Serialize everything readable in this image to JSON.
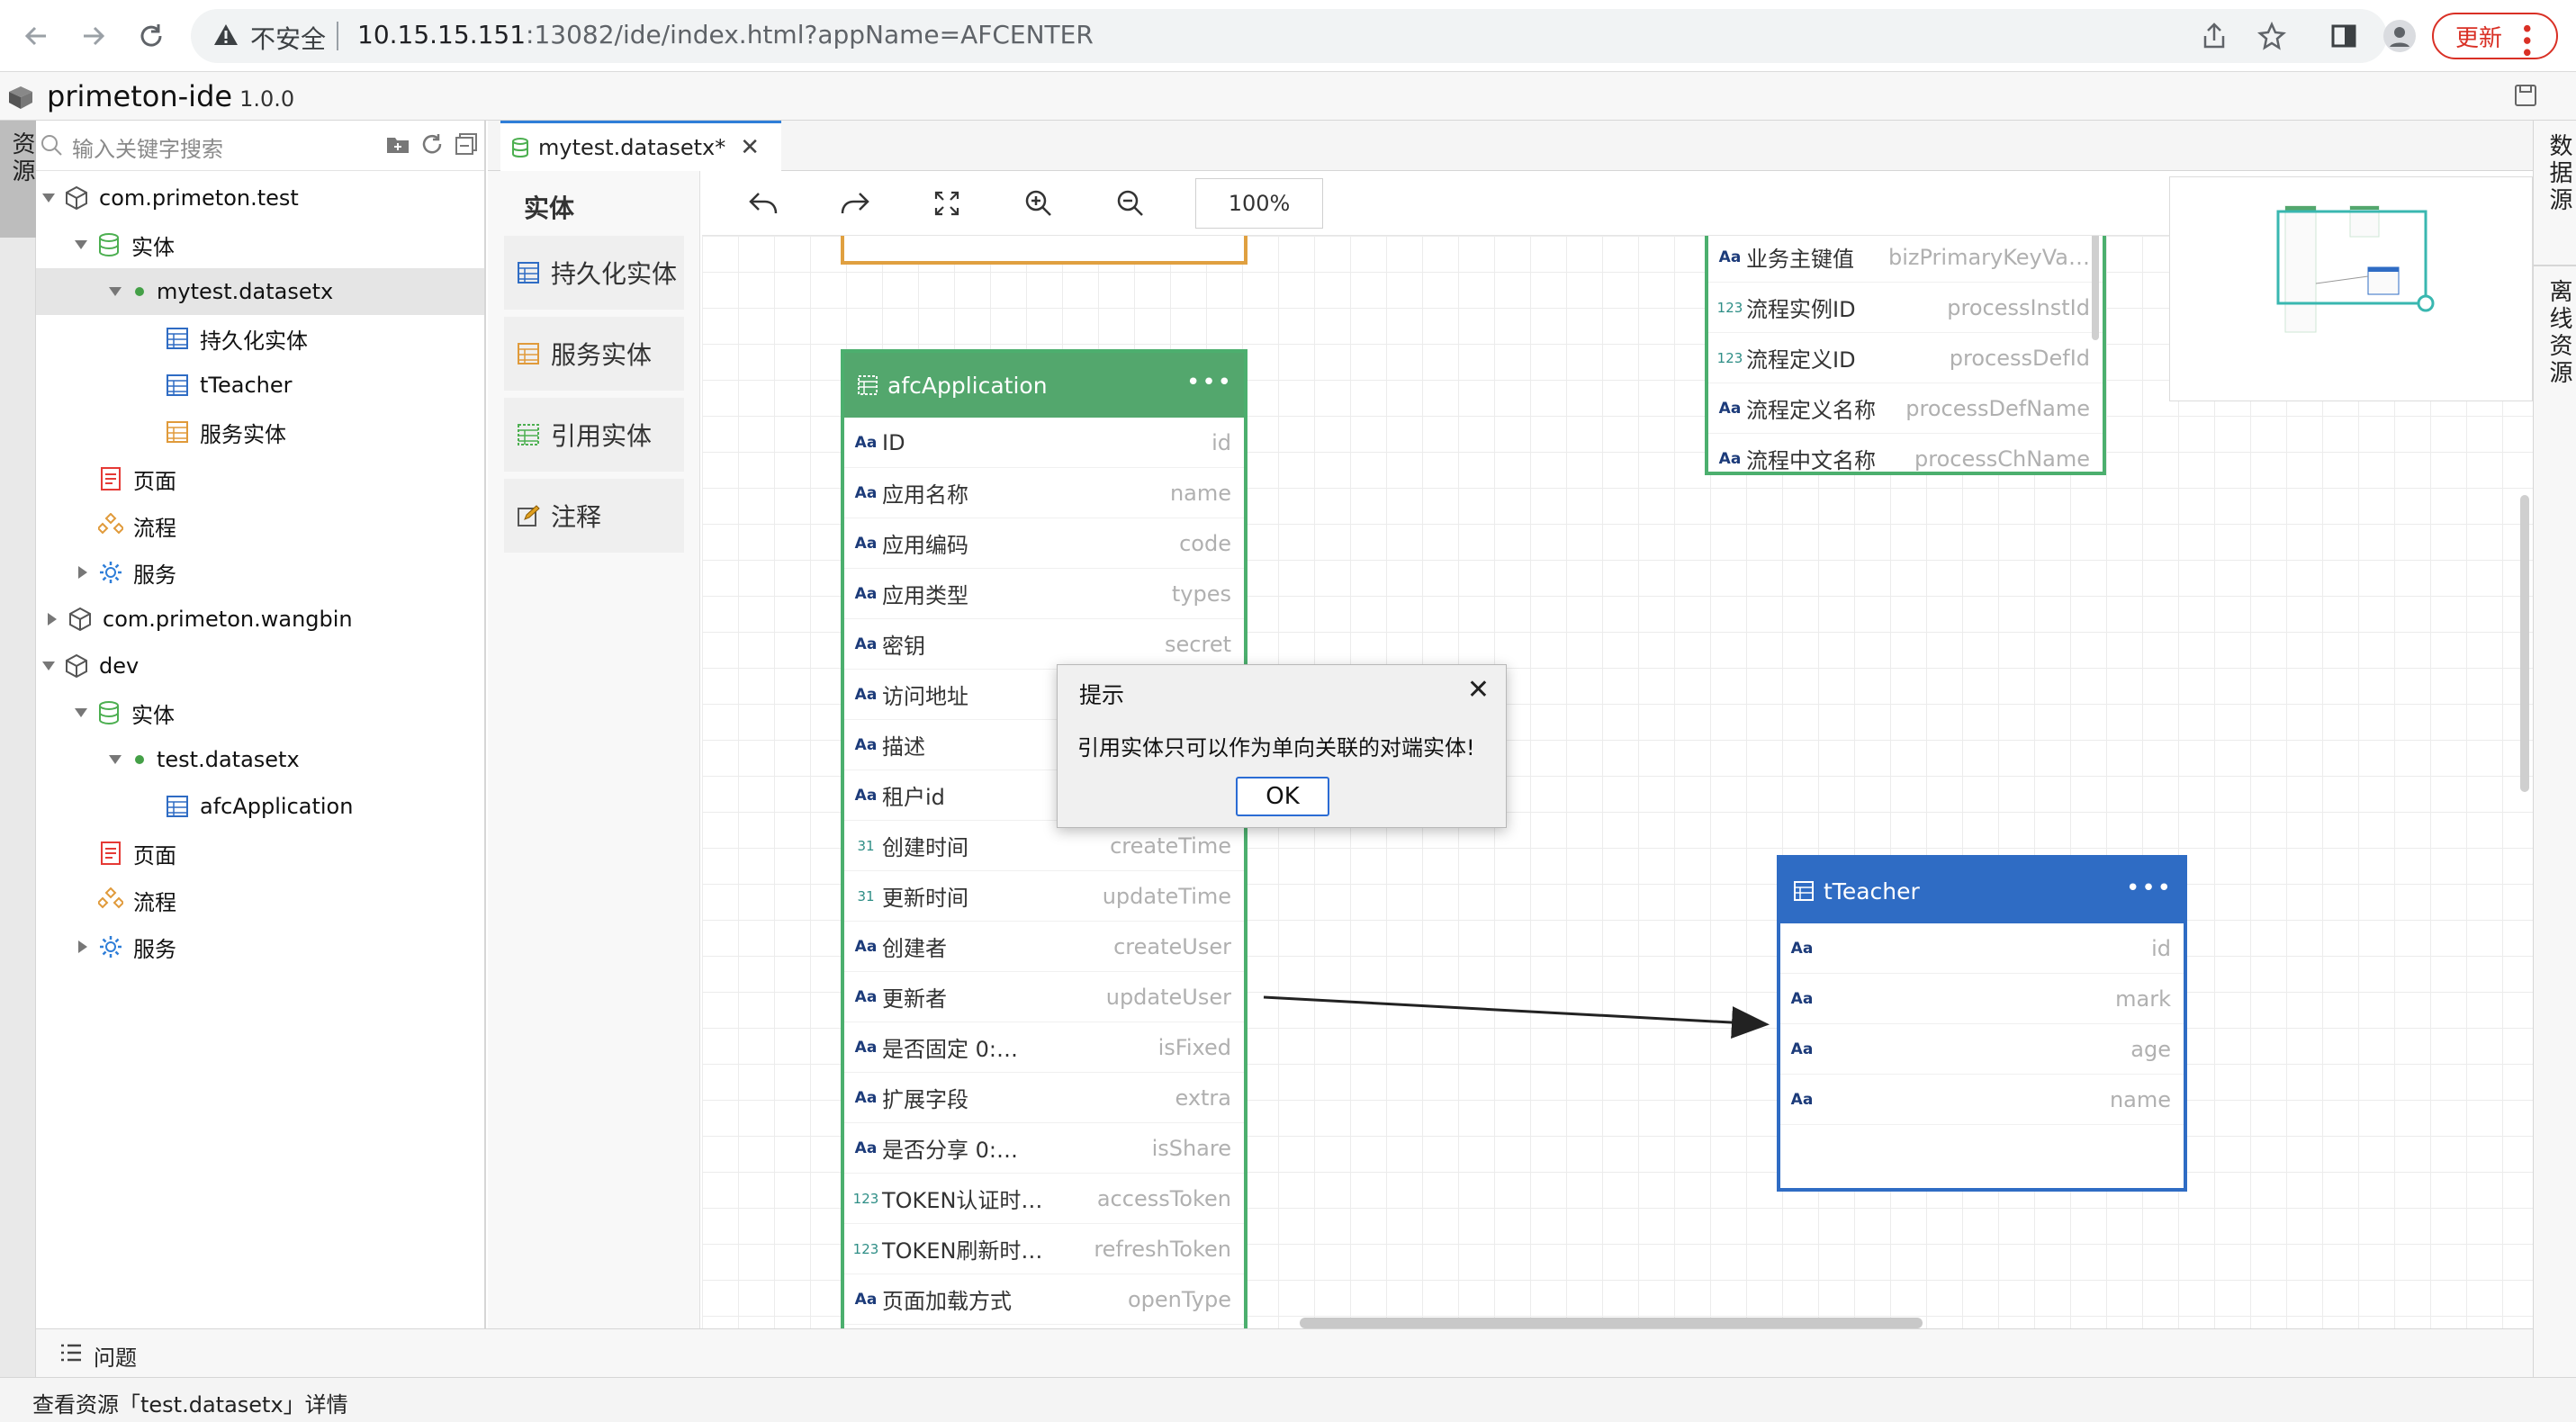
{
  "browser": {
    "insecure_label": "不安全",
    "url_host": "10.15.15.151",
    "url_rest": ":13082/ide/index.html?appName=AFCENTER",
    "update_label": "更新"
  },
  "app": {
    "title": "primeton-ide",
    "version": "1.0.0"
  },
  "left_strip": {
    "resources": "资源"
  },
  "right_strip": {
    "datasource": "数据源",
    "offline": "离线资源"
  },
  "tree": {
    "search_placeholder": "输入关键字搜索",
    "rows": [
      {
        "label": "com.primeton.test"
      },
      {
        "label": "实体"
      },
      {
        "label": "mytest.datasetx"
      },
      {
        "label": "持久化实体"
      },
      {
        "label": "tTeacher"
      },
      {
        "label": "服务实体"
      },
      {
        "label": "页面"
      },
      {
        "label": "流程"
      },
      {
        "label": "服务"
      },
      {
        "label": "com.primeton.wangbin"
      },
      {
        "label": "dev"
      },
      {
        "label": "实体"
      },
      {
        "label": "test.datasetx"
      },
      {
        "label": "afcApplication"
      },
      {
        "label": "页面"
      },
      {
        "label": "流程"
      },
      {
        "label": "服务"
      }
    ]
  },
  "editor": {
    "tab_label": "mytest.datasetx*",
    "palette_title": "实体",
    "palette": [
      "持久化实体",
      "服务实体",
      "引用实体",
      "注释"
    ],
    "zoom": "100%"
  },
  "entity_top": {
    "first_type": "Aa"
  },
  "entity_afc": {
    "title": "afcApplication",
    "fields": [
      {
        "type": "Aa",
        "label": "ID",
        "name": "id"
      },
      {
        "type": "Aa",
        "label": "应用名称",
        "name": "name"
      },
      {
        "type": "Aa",
        "label": "应用编码",
        "name": "code"
      },
      {
        "type": "Aa",
        "label": "应用类型",
        "name": "types"
      },
      {
        "type": "Aa",
        "label": "密钥",
        "name": "secret"
      },
      {
        "type": "Aa",
        "label": "访问地址",
        "name": ""
      },
      {
        "type": "Aa",
        "label": "描述",
        "name": ""
      },
      {
        "type": "Aa",
        "label": "租户id",
        "name": ""
      },
      {
        "type": "31",
        "label": "创建时间",
        "name": "createTime"
      },
      {
        "type": "31",
        "label": "更新时间",
        "name": "updateTime"
      },
      {
        "type": "Aa",
        "label": "创建者",
        "name": "createUser"
      },
      {
        "type": "Aa",
        "label": "更新者",
        "name": "updateUser"
      },
      {
        "type": "Aa",
        "label": "是否固定 0:…",
        "name": "isFixed"
      },
      {
        "type": "Aa",
        "label": "扩展字段",
        "name": "extra"
      },
      {
        "type": "Aa",
        "label": "是否分享 0:…",
        "name": "isShare"
      },
      {
        "type": "123",
        "label": "TOKEN认证时…",
        "name": "accessToken"
      },
      {
        "type": "123",
        "label": "TOKEN刷新时…",
        "name": "refreshToken"
      },
      {
        "type": "Aa",
        "label": "页面加载方式",
        "name": "openType"
      }
    ]
  },
  "entity_process": {
    "fields": [
      {
        "type": "Aa",
        "label": "业务主键值",
        "name": "bizPrimaryKeyVa…"
      },
      {
        "type": "123",
        "label": "流程实例ID",
        "name": "processInstId"
      },
      {
        "type": "123",
        "label": "流程定义ID",
        "name": "processDefId"
      },
      {
        "type": "Aa",
        "label": "流程定义名称",
        "name": "processDefName"
      },
      {
        "type": "Aa",
        "label": "流程中文名称",
        "name": "processChName"
      }
    ]
  },
  "entity_teacher": {
    "title": "tTeacher",
    "fields": [
      {
        "type": "Aa",
        "name": "id"
      },
      {
        "type": "Aa",
        "name": "mark"
      },
      {
        "type": "Aa",
        "name": "age"
      },
      {
        "type": "Aa",
        "name": "name"
      }
    ]
  },
  "dialog": {
    "title": "提示",
    "message": "引用实体只可以作为单向关联的对端实体!",
    "ok": "OK"
  },
  "bottom": {
    "problems": "问题",
    "status": "查看资源「test.datasetx」详情"
  },
  "colors": {
    "entity_green": "#53a76d",
    "entity_blue": "#2f6cc4",
    "update_red": "#d93025",
    "tab_accent": "#2f7ed8"
  }
}
